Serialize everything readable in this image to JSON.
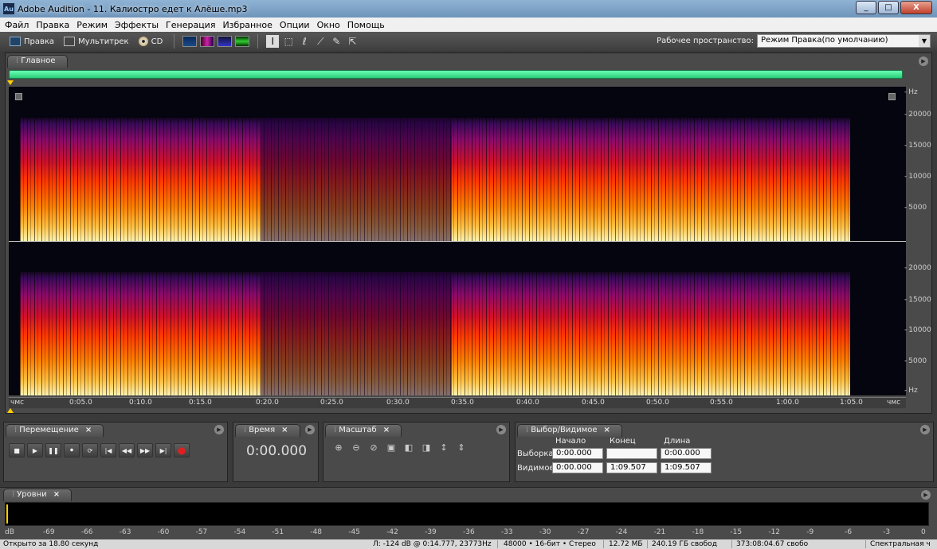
{
  "window": {
    "app_icon": "Au",
    "title": "Adobe Audition - 11. Калиостро едет к Алёше.mp3",
    "minimize": "_",
    "maximize": "□",
    "close": "X"
  },
  "menu": [
    "Файл",
    "Правка",
    "Режим",
    "Эффекты",
    "Генерация",
    "Избранное",
    "Опции",
    "Окно",
    "Помощь"
  ],
  "toolbar": {
    "edit_label": "Правка",
    "multitrack_label": "Мультитрек",
    "cd_label": "CD",
    "workspace_label": "Рабочее пространство:",
    "workspace_value": "Режим Правка(по умолчанию)",
    "tool_icons": [
      "time-selection-tool-icon",
      "marquee-tool-icon",
      "lasso-tool-icon",
      "brush-tool-icon",
      "spot-healing-icon",
      "scrub-tool-icon"
    ]
  },
  "editor": {
    "tab_label": "Главное",
    "freq_unit": "Hz",
    "freq_ticks": [
      "20000",
      "15000",
      "10000",
      "5000"
    ],
    "timeline": [
      "чмс",
      "0:05.0",
      "0:10.0",
      "0:15.0",
      "0:20.0",
      "0:25.0",
      "0:30.0",
      "0:35.0",
      "0:40.0",
      "0:45.0",
      "0:50.0",
      "0:55.0",
      "1:00.0",
      "1:05.0",
      "чмс"
    ]
  },
  "transport": {
    "tab_label": "Перемещение",
    "buttons": [
      "■",
      "▶",
      "❚❚",
      "⏺",
      "⟳",
      "|◀",
      "◀◀",
      "▶▶",
      "▶|",
      "●"
    ]
  },
  "time": {
    "tab_label": "Время",
    "value": "0:00.000"
  },
  "zoom": {
    "tab_label": "Масштаб"
  },
  "selection": {
    "tab_label": "Выбор/Видимое",
    "col_start": "Начало",
    "col_end": "Конец",
    "col_length": "Длина",
    "row_selection": "Выборка",
    "row_visible": "Видимое",
    "sel_start": "0:00.000",
    "sel_end": "",
    "sel_length": "0:00.000",
    "vis_start": "0:00.000",
    "vis_end": "1:09.507",
    "vis_length": "1:09.507"
  },
  "levels": {
    "tab_label": "Уровни",
    "scale": [
      "dB",
      "-69",
      "-66",
      "-63",
      "-60",
      "-57",
      "-54",
      "-51",
      "-48",
      "-45",
      "-42",
      "-39",
      "-36",
      "-33",
      "-30",
      "-27",
      "-24",
      "-21",
      "-18",
      "-15",
      "-12",
      "-9",
      "-6",
      "-3",
      "0"
    ]
  },
  "status": {
    "opened": "Открыто за 18.80 секунд",
    "cursor": "Л: -124 dB @ 0:14.777, 23773Hz",
    "format": "48000 • 16-бит • Стерео",
    "size": "12.72 МБ",
    "free_disk": "240.19 ГБ свобод",
    "free_time": "373:08:04.67 свобо",
    "view_mode": "Спектральная ч"
  },
  "colors": {
    "accent_green": "#2acc78",
    "spectrum_hot": "#ffc040",
    "record_red": "#e02020"
  }
}
